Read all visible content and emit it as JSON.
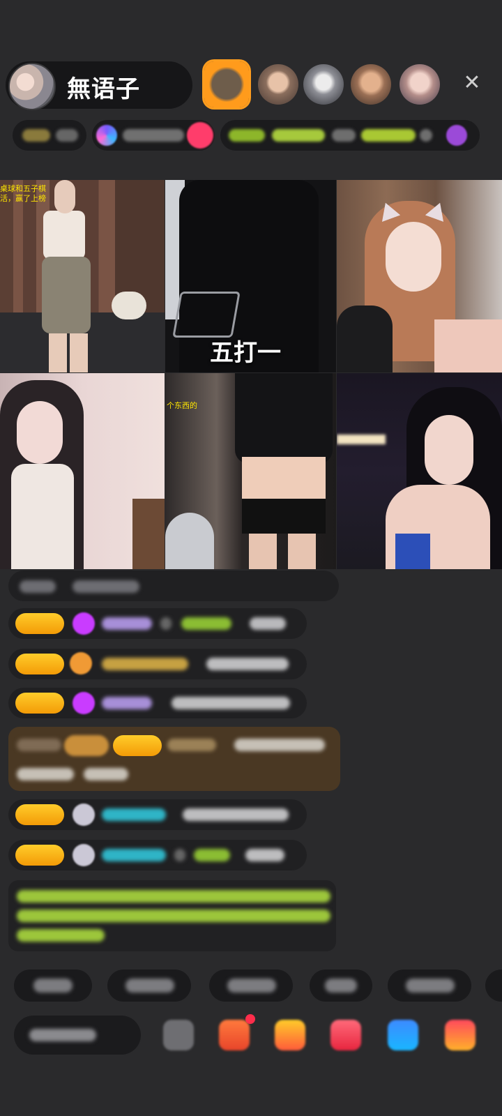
{
  "host": {
    "name": "無语子",
    "avatar_icon": "host-avatar-icon"
  },
  "top_bar": {
    "close_icon": "✕"
  },
  "video_tiles": [
    {
      "label": "",
      "caption": "",
      "overlay": "桌球和五子棋\n活，赢了上榜"
    },
    {
      "label": "五打一",
      "caption": "",
      "overlay": ""
    },
    {
      "label": "",
      "caption": "",
      "overlay": ""
    },
    {
      "label": "",
      "caption": "",
      "overlay": ""
    },
    {
      "label": "",
      "caption": "",
      "overlay": "个东西的"
    },
    {
      "label": "",
      "caption": "",
      "overlay": ""
    }
  ],
  "colors": {
    "background": "#2a2a2c",
    "badge_gold": "#f7b11a",
    "accent_pink": "#ff3d6b",
    "green_text": "#a2d63a",
    "teal_text": "#2fb4c6",
    "purple_text": "#b8a6e6"
  }
}
